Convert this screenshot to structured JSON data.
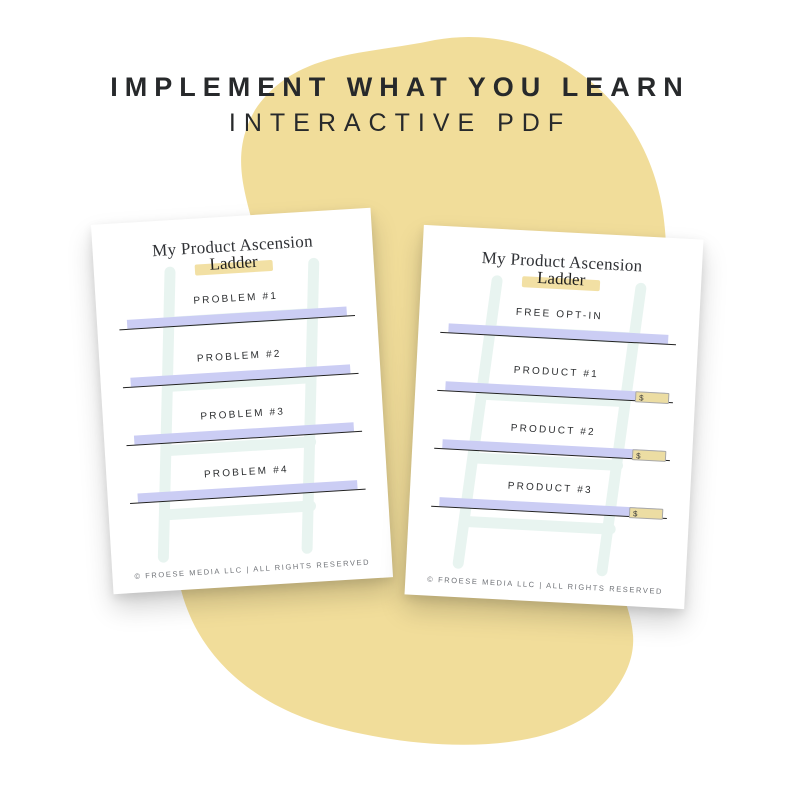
{
  "headline": {
    "line1": "IMPLEMENT WHAT YOU LEARN",
    "line2": "INTERACTIVE PDF"
  },
  "colors": {
    "background_blob": "#f1dd9a",
    "field_lavender": "#cbcdf4",
    "ladder_mint": "#d7ece5",
    "price_box": "#ecdda3"
  },
  "pages": [
    {
      "title": "My Product Ascension",
      "script": "Ladder",
      "rows": [
        {
          "label": "PROBLEM #1",
          "has_price": false
        },
        {
          "label": "PROBLEM #2",
          "has_price": false
        },
        {
          "label": "PROBLEM #3",
          "has_price": false
        },
        {
          "label": "PROBLEM #4",
          "has_price": false
        }
      ],
      "footer": "© FROESE MEDIA LLC | ALL RIGHTS RESERVED"
    },
    {
      "title": "My Product Ascension",
      "script": "Ladder",
      "rows": [
        {
          "label": "FREE OPT-IN",
          "has_price": false
        },
        {
          "label": "PRODUCT #1",
          "has_price": true,
          "price_symbol": "$"
        },
        {
          "label": "PRODUCT #2",
          "has_price": true,
          "price_symbol": "$"
        },
        {
          "label": "PRODUCT #3",
          "has_price": true,
          "price_symbol": "$"
        }
      ],
      "footer": "© FROESE MEDIA LLC | ALL RIGHTS RESERVED"
    }
  ]
}
